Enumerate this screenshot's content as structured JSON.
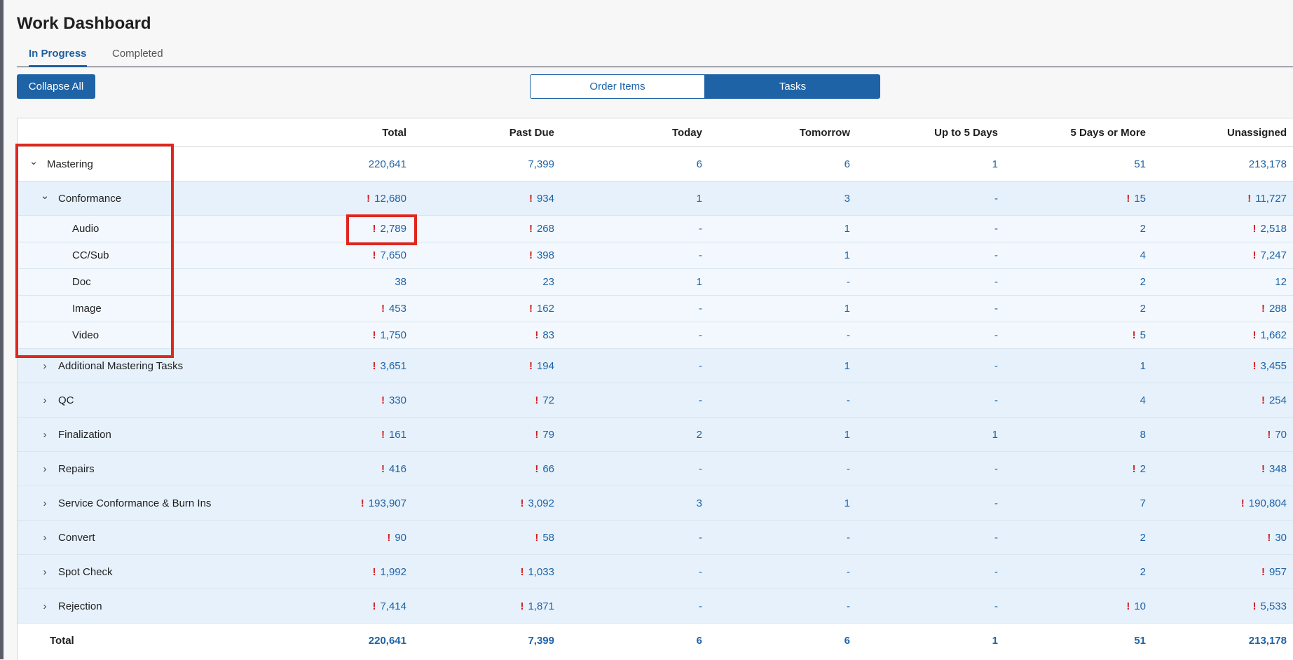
{
  "page_title": "Work Dashboard",
  "tabs": [
    {
      "label": "In Progress",
      "active": true
    },
    {
      "label": "Completed",
      "active": false
    }
  ],
  "toolbar": {
    "collapse_label": "Collapse All",
    "toggle": {
      "left": "Order Items",
      "right": "Tasks",
      "selected": "Tasks"
    }
  },
  "columns": [
    "Total",
    "Past Due",
    "Today",
    "Tomorrow",
    "Up to 5 Days",
    "5 Days or More",
    "Unassigned"
  ],
  "rows": [
    {
      "level": 0,
      "type": "top",
      "name": "Mastering",
      "chevron": "down",
      "cells": [
        [
          "220,641",
          false
        ],
        [
          "7,399",
          false
        ],
        [
          "6",
          false
        ],
        [
          "6",
          false
        ],
        [
          "1",
          false
        ],
        [
          "51",
          false
        ],
        [
          "213,178",
          false
        ]
      ]
    },
    {
      "level": 1,
      "type": "group",
      "name": "Conformance",
      "chevron": "down",
      "cells": [
        [
          "12,680",
          true
        ],
        [
          "934",
          true
        ],
        [
          "1",
          false
        ],
        [
          "3",
          false
        ],
        [
          "-",
          false
        ],
        [
          "15",
          true
        ],
        [
          "11,727",
          true
        ]
      ]
    },
    {
      "level": 2,
      "type": "child",
      "name": "Audio",
      "cells": [
        [
          "2,789",
          true
        ],
        [
          "268",
          true
        ],
        [
          "-",
          false
        ],
        [
          "1",
          false
        ],
        [
          "-",
          false
        ],
        [
          "2",
          false
        ],
        [
          "2,518",
          true
        ]
      ]
    },
    {
      "level": 2,
      "type": "child",
      "name": "CC/Sub",
      "cells": [
        [
          "7,650",
          true
        ],
        [
          "398",
          true
        ],
        [
          "-",
          false
        ],
        [
          "1",
          false
        ],
        [
          "-",
          false
        ],
        [
          "4",
          false
        ],
        [
          "7,247",
          true
        ]
      ]
    },
    {
      "level": 2,
      "type": "child",
      "name": "Doc",
      "cells": [
        [
          "38",
          false
        ],
        [
          "23",
          false
        ],
        [
          "1",
          false
        ],
        [
          "-",
          false
        ],
        [
          "-",
          false
        ],
        [
          "2",
          false
        ],
        [
          "12",
          false
        ]
      ]
    },
    {
      "level": 2,
      "type": "child",
      "name": "Image",
      "cells": [
        [
          "453",
          true
        ],
        [
          "162",
          true
        ],
        [
          "-",
          false
        ],
        [
          "1",
          false
        ],
        [
          "-",
          false
        ],
        [
          "2",
          false
        ],
        [
          "288",
          true
        ]
      ]
    },
    {
      "level": 2,
      "type": "child",
      "name": "Video",
      "cells": [
        [
          "1,750",
          true
        ],
        [
          "83",
          true
        ],
        [
          "-",
          false
        ],
        [
          "-",
          false
        ],
        [
          "-",
          false
        ],
        [
          "5",
          true
        ],
        [
          "1,662",
          true
        ]
      ]
    },
    {
      "level": 1,
      "type": "group",
      "name": "Additional Mastering Tasks",
      "chevron": "right",
      "cells": [
        [
          "3,651",
          true
        ],
        [
          "194",
          true
        ],
        [
          "-",
          false
        ],
        [
          "1",
          false
        ],
        [
          "-",
          false
        ],
        [
          "1",
          false
        ],
        [
          "3,455",
          true
        ]
      ]
    },
    {
      "level": 1,
      "type": "group",
      "name": "QC",
      "chevron": "right",
      "cells": [
        [
          "330",
          true
        ],
        [
          "72",
          true
        ],
        [
          "-",
          false
        ],
        [
          "-",
          false
        ],
        [
          "-",
          false
        ],
        [
          "4",
          false
        ],
        [
          "254",
          true
        ]
      ]
    },
    {
      "level": 1,
      "type": "group",
      "name": "Finalization",
      "chevron": "right",
      "cells": [
        [
          "161",
          true
        ],
        [
          "79",
          true
        ],
        [
          "2",
          false
        ],
        [
          "1",
          false
        ],
        [
          "1",
          false
        ],
        [
          "8",
          false
        ],
        [
          "70",
          true
        ]
      ]
    },
    {
      "level": 1,
      "type": "group",
      "name": "Repairs",
      "chevron": "right",
      "cells": [
        [
          "416",
          true
        ],
        [
          "66",
          true
        ],
        [
          "-",
          false
        ],
        [
          "-",
          false
        ],
        [
          "-",
          false
        ],
        [
          "2",
          true
        ],
        [
          "348",
          true
        ]
      ]
    },
    {
      "level": 1,
      "type": "group",
      "name": "Service Conformance & Burn Ins",
      "chevron": "right",
      "cells": [
        [
          "193,907",
          true
        ],
        [
          "3,092",
          true
        ],
        [
          "3",
          false
        ],
        [
          "1",
          false
        ],
        [
          "-",
          false
        ],
        [
          "7",
          false
        ],
        [
          "190,804",
          true
        ]
      ]
    },
    {
      "level": 1,
      "type": "group",
      "name": "Convert",
      "chevron": "right",
      "cells": [
        [
          "90",
          true
        ],
        [
          "58",
          true
        ],
        [
          "-",
          false
        ],
        [
          "-",
          false
        ],
        [
          "-",
          false
        ],
        [
          "2",
          false
        ],
        [
          "30",
          true
        ]
      ]
    },
    {
      "level": 1,
      "type": "group",
      "name": "Spot Check",
      "chevron": "right",
      "cells": [
        [
          "1,992",
          true
        ],
        [
          "1,033",
          true
        ],
        [
          "-",
          false
        ],
        [
          "-",
          false
        ],
        [
          "-",
          false
        ],
        [
          "2",
          false
        ],
        [
          "957",
          true
        ]
      ]
    },
    {
      "level": 1,
      "type": "group",
      "name": "Rejection",
      "chevron": "right",
      "cells": [
        [
          "7,414",
          true
        ],
        [
          "1,871",
          true
        ],
        [
          "-",
          false
        ],
        [
          "-",
          false
        ],
        [
          "-",
          false
        ],
        [
          "10",
          true
        ],
        [
          "5,533",
          true
        ]
      ]
    }
  ],
  "total_row": {
    "name": "Total",
    "cells": [
      "220,641",
      "7,399",
      "6",
      "6",
      "1",
      "51",
      "213,178"
    ]
  },
  "colors": {
    "accent": "#1e63a6",
    "alert": "#d32020",
    "highlight": "#e0261d",
    "group_bg": "#e6f1fb",
    "child_bg": "#f2f8fd"
  }
}
